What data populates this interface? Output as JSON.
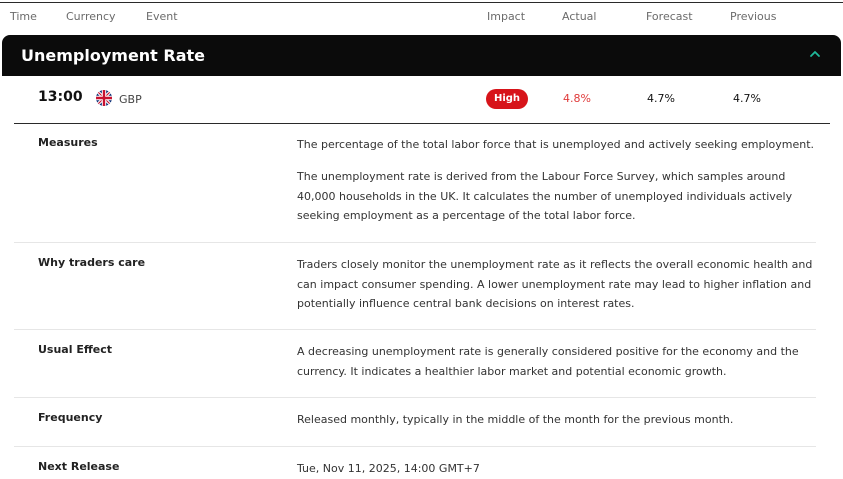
{
  "columns": {
    "time": "Time",
    "currency": "Currency",
    "event": "Event",
    "impact": "Impact",
    "actual": "Actual",
    "forecast": "Forecast",
    "previous": "Previous"
  },
  "event": {
    "title": "Unemployment Rate",
    "expanded": true,
    "time": "13:00",
    "currency": "GBP",
    "flag_icon": "uk-flag-icon",
    "impact": "High",
    "actual": "4.8%",
    "forecast": "4.7%",
    "previous": "4.7%"
  },
  "colors": {
    "header_bg": "#0b0b0b",
    "accent_teal": "#1fb89a",
    "impact_high": "#d7141a",
    "actual_worse": "#e03a3a"
  },
  "details": {
    "measures": {
      "label": "Measures",
      "p1": "The percentage of the total labor force that is unemployed and actively seeking employment.",
      "p2": "The unemployment rate is derived from the Labour Force Survey, which samples around 40,000 households in the UK. It calculates the number of unemployed individuals actively seeking employment as a percentage of the total labor force."
    },
    "why": {
      "label": "Why traders care",
      "text": "Traders closely monitor the unemployment rate as it reflects the overall economic health and can impact consumer spending. A lower unemployment rate may lead to higher inflation and potentially influence central bank decisions on interest rates."
    },
    "effect": {
      "label": "Usual Effect",
      "text": "A decreasing unemployment rate is generally considered positive for the economy and the currency. It indicates a healthier labor market and potential economic growth."
    },
    "frequency": {
      "label": "Frequency",
      "text": "Released monthly, typically in the middle of the month for the previous month."
    },
    "next_release": {
      "label": "Next Release",
      "text": "Tue, Nov 11, 2025, 14:00 GMT+7"
    }
  }
}
